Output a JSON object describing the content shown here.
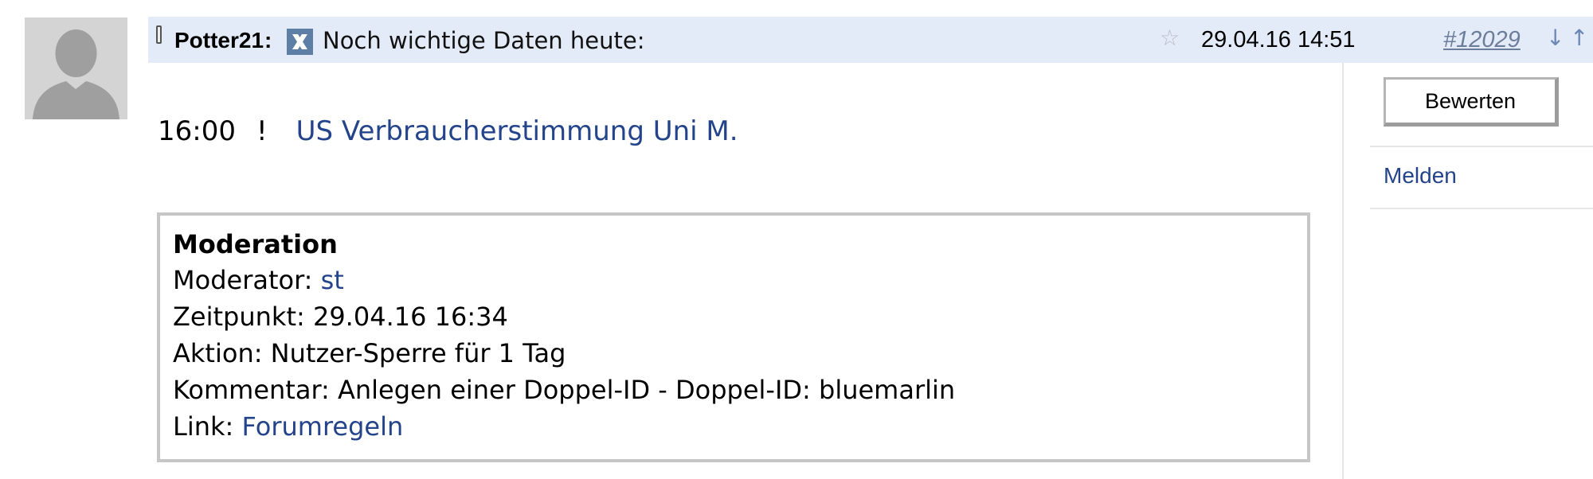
{
  "post": {
    "username": "Potter21",
    "username_colon": ":",
    "title": "Noch wichtige Daten heute:",
    "date": "29.04.16 14:51",
    "number": "#12029",
    "arrow_down": "↓",
    "arrow_up": "↑",
    "star": "☆"
  },
  "body": {
    "time": "16:00",
    "marker": "!",
    "link_text": "US Verbraucherstimmung Uni M."
  },
  "sidebar": {
    "rate_label": "Bewerten",
    "report_label": "Melden"
  },
  "moderation": {
    "heading": "Moderation",
    "moderator_label": "Moderator: ",
    "moderator_value": "st",
    "time_label": "Zeitpunkt: ",
    "time_value": "29.04.16 16:34",
    "action_label": "Aktion: ",
    "action_value": "Nutzer-Sperre für 1 Tag",
    "comment_label": "Kommentar: ",
    "comment_value": "Anlegen einer Doppel-ID - Doppel-ID: bluemarlin",
    "link_label": "Link: ",
    "link_value": "Forumregeln"
  },
  "icons": {
    "avatar": "default-avatar-icon",
    "device": "mobile-icon",
    "profile": "xing-icon",
    "favorite": "star-icon"
  },
  "colors": {
    "header_bg": "#e3ebf8",
    "link": "#23438a",
    "post_number": "#6c7d9a",
    "moderation_border": "#c6c6c6"
  }
}
